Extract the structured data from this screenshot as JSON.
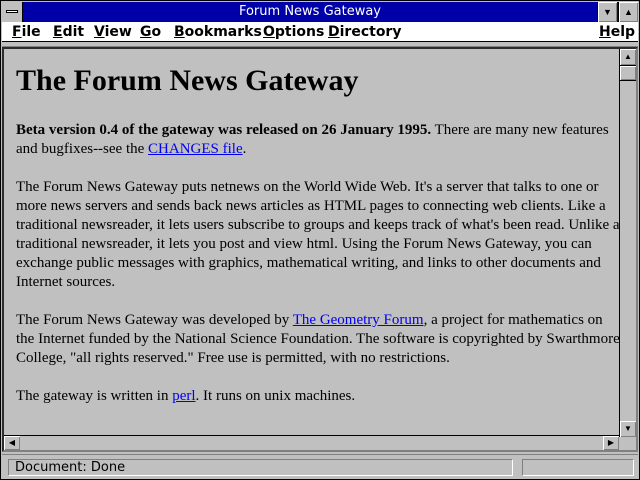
{
  "window": {
    "title": "Forum News Gateway"
  },
  "menubar": {
    "items": [
      "File",
      "Edit",
      "View",
      "Go",
      "Bookmarks",
      "Options",
      "Directory"
    ],
    "help": "Help"
  },
  "page": {
    "heading": "The Forum News Gateway",
    "p1_bold": "Beta version 0.4 of the gateway was released on 26 January 1995.",
    "p1_text": " There are many new features and bugfixes--see the ",
    "p1_link": "CHANGES file",
    "p1_end": ".",
    "p2": "The Forum News Gateway puts netnews on the World Wide Web. It's a server that talks to one or more news servers and sends back news articles as HTML pages to connecting web clients. Like a traditional newsreader, it lets users subscribe to groups and keeps track of what's been read. Unlike a traditional newsreader, it lets you post and view html. Using the Forum News Gateway, you can exchange public messages with graphics, mathematical writing, and links to other documents and Internet sources.",
    "p3_text": "The Forum News Gateway was developed by ",
    "p3_link": "The Geometry Forum",
    "p3_rest": ", a project for mathematics on the Internet funded by the National Science Foundation. The software is copyrighted by Swarthmore College, \"all rights reserved.\" Free use is permitted, with no restrictions.",
    "p4_text": "The gateway is written in ",
    "p4_link": "perl",
    "p4_rest": ". It runs on unix machines."
  },
  "status": {
    "text": "Document: Done"
  },
  "colors": {
    "titlebar": "#0000a8",
    "link": "#0000ee",
    "background": "#c0c0c0"
  },
  "icons": [
    "system-menu-icon",
    "minimize-icon",
    "maximize-icon",
    "scroll-up-icon",
    "scroll-down-icon",
    "scroll-left-icon",
    "scroll-right-icon"
  ]
}
